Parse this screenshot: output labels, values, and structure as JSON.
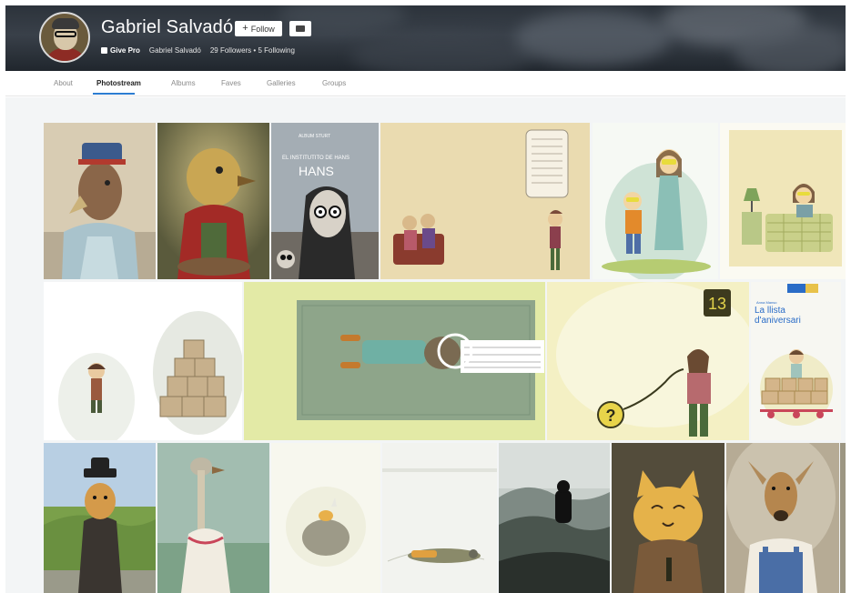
{
  "profile": {
    "name": "Gabriel Salvadó",
    "follow_label": "Follow",
    "pro_label": "Give Pro",
    "username": "Gabriel Salvadó",
    "followers": "29 Followers",
    "separator": "•",
    "following": "5 Following"
  },
  "tabs": [
    {
      "label": "About"
    },
    {
      "label": "Photostream"
    },
    {
      "label": "Albums"
    },
    {
      "label": "Faves"
    },
    {
      "label": "Galleries"
    },
    {
      "label": "Groups"
    }
  ],
  "active_tab": "Photostream",
  "colors": {
    "accent": "#2d7dd2",
    "cover": "#2c333b"
  },
  "photos": {
    "row1": [
      {
        "subject": "bird in blue uniform"
      },
      {
        "subject": "bird in red jacket"
      },
      {
        "subject": "book cover",
        "cover_title": "HANS",
        "cover_subtitle": "EL INSTITUTITO DE HANS",
        "author": "ALBUM STURT"
      },
      {
        "subject": "couple on sofa and child"
      },
      {
        "subject": "two children"
      },
      {
        "subject": "child in bed"
      }
    ],
    "row2": [
      {
        "subject": "boy and boxes"
      },
      {
        "subject": "figure lying on rug"
      },
      {
        "subject": "child with number 13",
        "number": "13",
        "mark": "?"
      },
      {
        "subject": "book cover",
        "cover_title": "La llista d'aniversari",
        "author": "Anna Manso"
      }
    ],
    "row3": [
      {
        "subject": "dog in suit"
      },
      {
        "subject": "ostrich in dress"
      },
      {
        "subject": "bird on egg"
      },
      {
        "subject": "fallen figure"
      },
      {
        "subject": "silhouette landscape"
      },
      {
        "subject": "cat poster"
      },
      {
        "subject": "deer in overalls"
      }
    ]
  }
}
